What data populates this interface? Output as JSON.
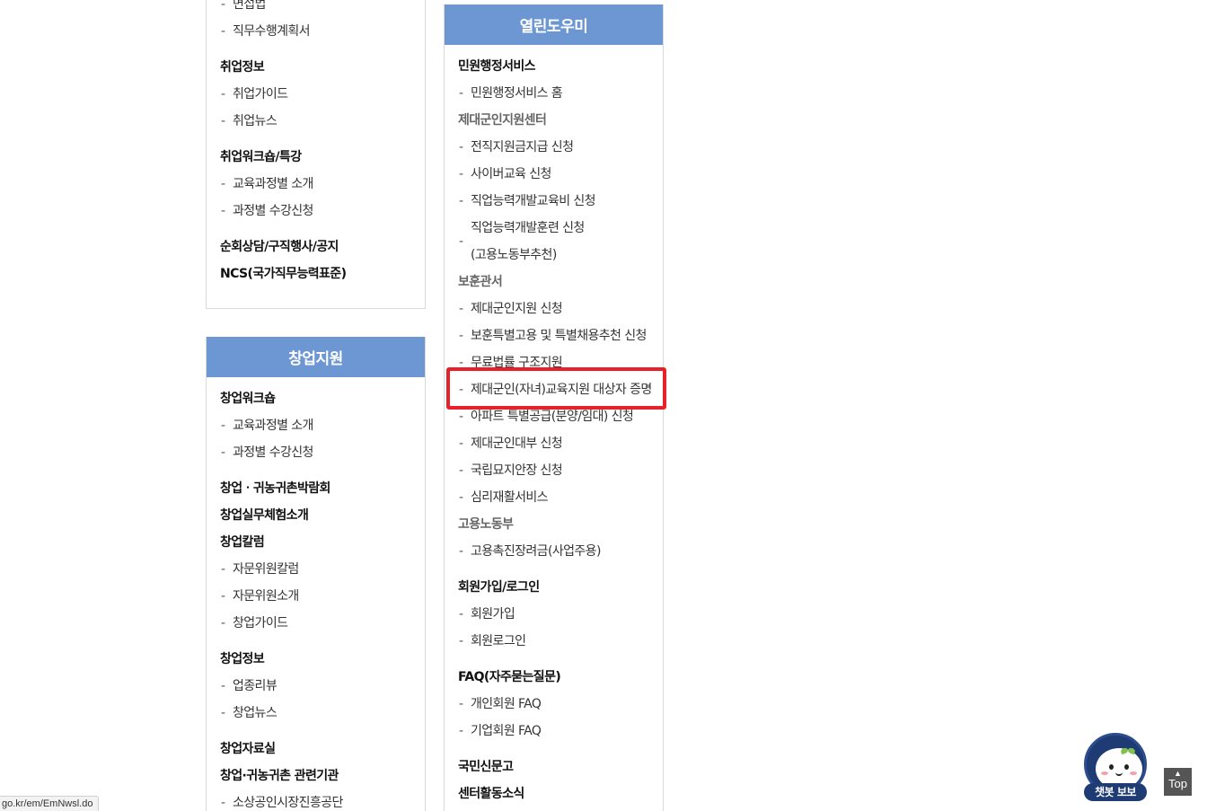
{
  "left_top_box": {
    "items": [
      {
        "text": "면접법",
        "kind": "sub"
      },
      {
        "text": "직무수행계획서",
        "kind": "sub"
      },
      {
        "text": "취업정보",
        "kind": "grp",
        "gap": true
      },
      {
        "text": "취업가이드",
        "kind": "sub"
      },
      {
        "text": "취업뉴스",
        "kind": "sub"
      },
      {
        "text": "취업워크숍/특강",
        "kind": "grp",
        "gap": true
      },
      {
        "text": "교육과정별 소개",
        "kind": "sub"
      },
      {
        "text": "과정별 수강신청",
        "kind": "sub"
      },
      {
        "text": "순회상담/구직행사/공지",
        "kind": "grp",
        "gap": true
      },
      {
        "text": "NCS(국가직무능력표준)",
        "kind": "grp"
      }
    ]
  },
  "left_bottom_box": {
    "title": "창업지원",
    "items": [
      {
        "text": "창업워크숍",
        "kind": "grp"
      },
      {
        "text": "교육과정별 소개",
        "kind": "sub"
      },
      {
        "text": "과정별 수강신청",
        "kind": "sub"
      },
      {
        "text": "창업ㆍ귀농귀촌박람회",
        "kind": "grp",
        "gap": true
      },
      {
        "text": "창업실무체험소개",
        "kind": "grp"
      },
      {
        "text": "창업칼럼",
        "kind": "grp"
      },
      {
        "text": "자문위원칼럼",
        "kind": "sub"
      },
      {
        "text": "자문위원소개",
        "kind": "sub"
      },
      {
        "text": "창업가이드",
        "kind": "sub"
      },
      {
        "text": "창업정보",
        "kind": "grp",
        "gap": true
      },
      {
        "text": "업종리뷰",
        "kind": "sub"
      },
      {
        "text": "창업뉴스",
        "kind": "sub"
      },
      {
        "text": "창업자료실",
        "kind": "grp",
        "gap": true
      },
      {
        "text": "창업·귀농귀촌 관련기관",
        "kind": "grp"
      },
      {
        "text": "소상공인시장진흥공단",
        "kind": "sub"
      }
    ]
  },
  "right_box": {
    "title": "열린도우미",
    "items": [
      {
        "text": "민원행정서비스",
        "kind": "grp"
      },
      {
        "text": "민원행정서비스 홈",
        "kind": "sub"
      },
      {
        "text": "제대군인지원센터",
        "kind": "grp-gray"
      },
      {
        "text": "전직지원금지급 신청",
        "kind": "sub"
      },
      {
        "text": "사이버교육 신청",
        "kind": "sub"
      },
      {
        "text": "직업능력개발교육비 신청",
        "kind": "sub"
      },
      {
        "text": "직업능력개발훈련 신청",
        "text2": "(고용노동부추천)",
        "kind": "sub-two"
      },
      {
        "text": "보훈관서",
        "kind": "grp-gray"
      },
      {
        "text": "제대군인지원 신청",
        "kind": "sub"
      },
      {
        "text": "보훈특별고용 및 특별채용추천 신청",
        "kind": "sub"
      },
      {
        "text": "무료법률 구조지원",
        "kind": "sub"
      },
      {
        "text": "제대군인(자녀)교육지원 대상자 증명",
        "kind": "sub"
      },
      {
        "text": "아파트 특별공급(분양/임대) 신청",
        "kind": "sub"
      },
      {
        "text": "제대군인대부 신청",
        "kind": "sub"
      },
      {
        "text": "국립묘지안장 신청",
        "kind": "sub"
      },
      {
        "text": "심리재활서비스",
        "kind": "sub"
      },
      {
        "text": "고용노동부",
        "kind": "grp-gray"
      },
      {
        "text": "고용촉진장려금(사업주용)",
        "kind": "sub"
      },
      {
        "text": "회원가입/로그인",
        "kind": "grp",
        "gap": true
      },
      {
        "text": "회원가입",
        "kind": "sub"
      },
      {
        "text": "회원로그인",
        "kind": "sub"
      },
      {
        "text": "FAQ(자주묻는질문)",
        "kind": "grp",
        "gap": true
      },
      {
        "text": "개인회원 FAQ",
        "kind": "sub"
      },
      {
        "text": "기업회원 FAQ",
        "kind": "sub"
      },
      {
        "text": "국민신문고",
        "kind": "grp",
        "gap": true
      },
      {
        "text": "센터활동소식",
        "kind": "grp"
      }
    ]
  },
  "status_url": "go.kr/em/EmNwsl.do",
  "chatbot_label": "챗봇 보보",
  "top_button": {
    "arrow": "▲",
    "label": "Top"
  },
  "colors": {
    "header_blue": "#6d97d2",
    "highlight_red": "#e8202a"
  }
}
